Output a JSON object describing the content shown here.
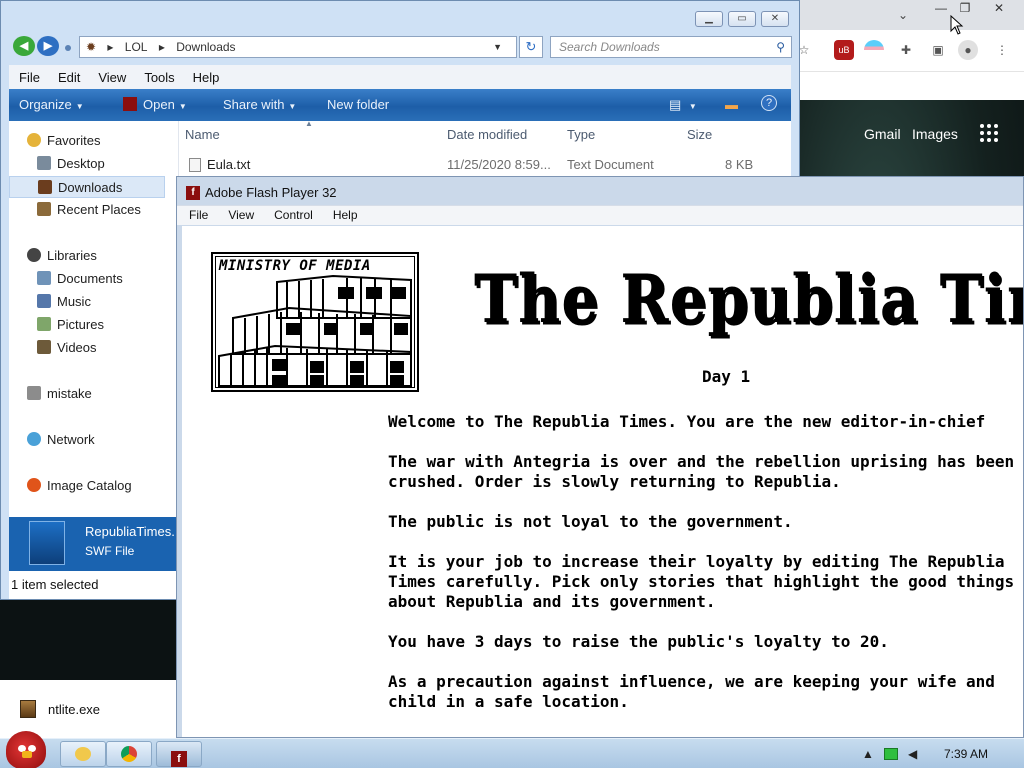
{
  "chrome": {
    "links": [
      "Gmail",
      "Images"
    ],
    "caption": {
      "min": "—",
      "restore": "❐",
      "close": "✕"
    },
    "toolbar_icons": [
      "star-icon",
      "ublock-icon",
      "profile-flag-icon",
      "extensions-icon",
      "side-panel-icon",
      "account-icon",
      "more-icon"
    ]
  },
  "explorer": {
    "breadcrumb": [
      "LOL",
      "Downloads"
    ],
    "search_placeholder": "Search Downloads",
    "menu": [
      "File",
      "Edit",
      "View",
      "Tools",
      "Help"
    ],
    "commands": {
      "organize": "Organize",
      "open": "Open",
      "share": "Share with",
      "newfolder": "New folder"
    },
    "nav": [
      {
        "label": "Favorites",
        "icon": "star-icon"
      },
      {
        "label": "Desktop",
        "icon": "desktop-icon"
      },
      {
        "label": "Downloads",
        "icon": "downloads-icon"
      },
      {
        "label": "Recent Places",
        "icon": "recent-places-icon"
      },
      {
        "label": "Libraries",
        "icon": "libraries-icon"
      },
      {
        "label": "Documents",
        "icon": "documents-icon"
      },
      {
        "label": "Music",
        "icon": "music-icon"
      },
      {
        "label": "Pictures",
        "icon": "pictures-icon"
      },
      {
        "label": "Videos",
        "icon": "videos-icon"
      },
      {
        "label": "mistake",
        "icon": "homegroup-icon"
      },
      {
        "label": "Network",
        "icon": "network-icon"
      },
      {
        "label": "Image Catalog",
        "icon": "image-catalog-icon"
      }
    ],
    "columns": {
      "name": "Name",
      "date": "Date modified",
      "type": "Type",
      "size": "Size"
    },
    "files": [
      {
        "name": "Eula.txt",
        "date": "11/25/2020 8:59...",
        "type": "Text Document",
        "size": "8 KB"
      }
    ],
    "preview": {
      "name": "RepubliaTimes.",
      "type": "SWF File"
    },
    "status": "1 item selected"
  },
  "desktop": {
    "item": "ntlite.exe"
  },
  "flash": {
    "title": "Adobe Flash Player 32",
    "menu": [
      "File",
      "View",
      "Control",
      "Help"
    ],
    "ministry": "MINISTRY OF MEDIA",
    "masthead": "The Republia Times",
    "day": "Day 1",
    "paragraphs": [
      "Welcome to The Republia Times. You are the new editor-in-chief",
      "The war with Antegria is over and the rebellion uprising has been\ncrushed. Order is slowly returning to Republia.",
      "The public is not loyal to the government.",
      "It is your job to increase their loyalty by editing The Republia\nTimes carefully. Pick only stories that highlight the good things\nabout Republia and its government.",
      "You have 3 days to raise the public's loyalty to 20.",
      "As a precaution against influence, we are keeping your wife and\nchild in a safe location."
    ]
  },
  "taskbar": {
    "clock": "7:39 AM",
    "buttons": [
      "explorer-icon",
      "chrome-icon",
      "flash-player-icon"
    ]
  }
}
